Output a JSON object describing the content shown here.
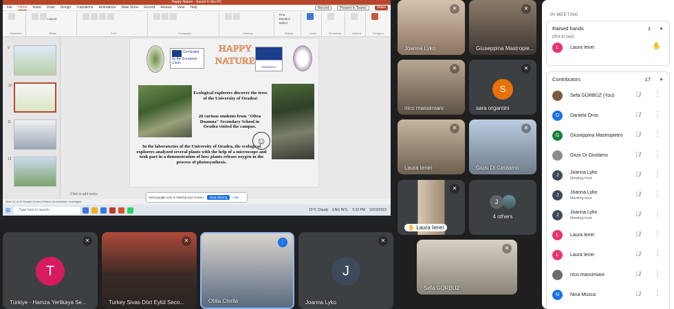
{
  "ppt": {
    "window_title": "Happy Nature - Saved to this PC",
    "search": "Search",
    "menu": [
      "File",
      "Home",
      "Insert",
      "Draw",
      "Design",
      "Transitions",
      "Animations",
      "Slide Show",
      "Record",
      "Review",
      "View",
      "Help"
    ],
    "record_btn": "Record",
    "present_btn": "Present in Teams",
    "share_btn": "Share",
    "ribbon_groups": [
      "Clipboard",
      "Slides",
      "Font",
      "Paragraph",
      "Drawing",
      "Editing",
      "Voice",
      "Sensitivity",
      "Add-ins",
      "Designer"
    ],
    "ribbon_buttons": {
      "paste": "Paste",
      "new_slide": "New Slide",
      "reuse": "Reuse Slides",
      "layout": "Layout",
      "reset": "Reset",
      "section": "Section",
      "find": "Find",
      "replace": "Replace",
      "select": "Select",
      "dictate": "Dictate",
      "sensitivity": "Sensitivity",
      "addins": "Add-ins",
      "designer": "Designer"
    },
    "thumb_numbers": [
      "9",
      "10",
      "11",
      "12"
    ],
    "notes_placeholder": "Click to add notes",
    "statusbar": "Slide 10 of 24   English (United States)   Accessibility: Investigate",
    "slide": {
      "title_line1": "HAPPY",
      "title_line2": "NATURE",
      "cofunded": "Co-funded by the European Union",
      "erasmus": "ERASMUS+",
      "text1": "Ecological explorers discover the trees of the University of Oradea!",
      "text2": "26 curious students from \"Oltea Doamna\" Secondary School in Oradea visited the campus.",
      "text3": "In the laboratories of the University of Oradea, the ecological explorers analyzed several plants with the help of a microscope and took part in a demonstration of how plants release oxygen in the process of photosynthesis."
    }
  },
  "share_banner": {
    "text": "meet.google.com is sharing your screen.",
    "stop": "Stop sharing",
    "hide": "Hide"
  },
  "taskbar": {
    "search": "Type here to search",
    "weather": "15°C Cloudy",
    "lang": "ENG INTL",
    "time": "5:33 PM",
    "date": "10/19/2023"
  },
  "tiles": {
    "joanna_top": "Joanna Lyko",
    "giuseppina": "Giuseppina Mastropie...",
    "nico": "nico massimiani",
    "sara": "sara organtini",
    "sara_initial": "S",
    "laura1": "Laura Ienei",
    "giusi": "Giusi Di Girolamo",
    "laura2": "Laura Ienei",
    "others_label": "4 others",
    "others_initial": "J",
    "sefa": "Sefa GÜRBÜZ",
    "turkiye1": "Türkiye - Hamza Yerlikaya Se...",
    "turkiye1_initial": "T",
    "turkiye2": "Turkey Sivas Dört Eylül Seco...",
    "otilia": "Otilia Chirila",
    "joanna_bottom": "Joanna Lyko",
    "joanna_bottom_initial": "J"
  },
  "panel": {
    "in_meeting": "IN MEETING",
    "raised_hands": {
      "label": "Raised hands",
      "count": "1",
      "order": "(first to last)",
      "person": "Laura Ienei",
      "initial": "L"
    },
    "contributors": {
      "label": "Contributors",
      "count": "17"
    },
    "people": [
      {
        "name": "Sefa GÜRBÜZ (You)",
        "sub": "",
        "initial": "",
        "color": "#7a5a3a"
      },
      {
        "name": "Daniela Oros",
        "sub": "",
        "initial": "D",
        "color": "#1a73e8"
      },
      {
        "name": "Giuseppina Mastropietro",
        "sub": "",
        "initial": "G",
        "color": "#188038"
      },
      {
        "name": "Giusi Di Girolamo",
        "sub": "",
        "initial": "",
        "color": "#8d8d8d"
      },
      {
        "name": "Joanna Lyko",
        "sub": "Meeting host",
        "initial": "J",
        "color": "#3c4a5a"
      },
      {
        "name": "Joanna Lyko",
        "sub": "Meeting host",
        "initial": "J",
        "color": "#3c4a5a"
      },
      {
        "name": "Joanna Lyko",
        "sub": "Meeting host",
        "initial": "J",
        "color": "#3c4a5a"
      },
      {
        "name": "Laura Ienei",
        "sub": "",
        "initial": "L",
        "color": "#e8336d"
      },
      {
        "name": "Laura Ienei",
        "sub": "",
        "initial": "L",
        "color": "#e8336d"
      },
      {
        "name": "nico massimiani",
        "sub": "",
        "initial": "",
        "color": "#6d6d6d"
      },
      {
        "name": "Nina Musca",
        "sub": "",
        "initial": "N",
        "color": "#1a73e8"
      }
    ]
  },
  "colors": {
    "accent": "#b7472a",
    "meet_bg": "#202124",
    "tile": "#3c4043",
    "blue": "#1a73e8"
  }
}
